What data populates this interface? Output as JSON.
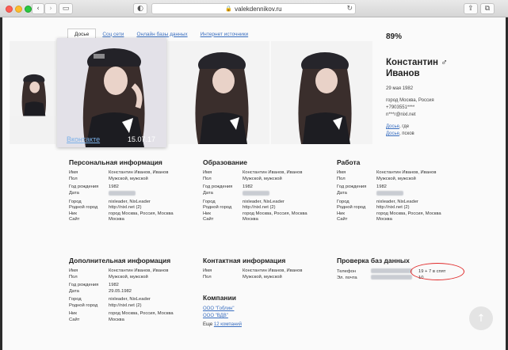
{
  "browser": {
    "url": "valekdennikov.ru"
  },
  "tabs": [
    "Досье",
    "Соц сети",
    "Онлайн базы данных",
    "Интернет источники"
  ],
  "match_percent": "89%",
  "photo": {
    "caption": "Вконтакте",
    "date": "15.07.17"
  },
  "profile": {
    "name_line1": "Константин ♂",
    "name_line2": "Иванов",
    "birth": "29 мая 1982",
    "city": "город Москва, Россия",
    "phone": "+7903551****",
    "email": "n***r@nixl.net",
    "link1": "Досье",
    "link1_rest": ", где",
    "link2": "Досье",
    "link2_rest": ", псков"
  },
  "personal": {
    "title": "Персональная информация",
    "rows": [
      {
        "k": "Имя",
        "v": "Константин Иванов, Иванов"
      },
      {
        "k": "Пол",
        "v": "Мужской, мужской"
      },
      {
        "k": "Год рождения",
        "v": "1982"
      },
      {
        "k": "Дата",
        "v": ""
      },
      {
        "k": "Город",
        "v": "nixleader, NixLeader"
      },
      {
        "k": "Родной город",
        "v": "http://nixl.net (2)"
      },
      {
        "k": "Ник",
        "v": "город Москва, Россия, Москва"
      },
      {
        "k": "Сайт",
        "v": "Москва"
      }
    ]
  },
  "education": {
    "title": "Образование",
    "rows": [
      {
        "k": "Имя",
        "v": "Константин Иванов, Иванов"
      },
      {
        "k": "Пол",
        "v": "Мужской, мужской"
      },
      {
        "k": "Год рождения",
        "v": "1982"
      },
      {
        "k": "Дата",
        "v": ""
      },
      {
        "k": "Город",
        "v": "nixleader, NixLeader"
      },
      {
        "k": "Родной город",
        "v": "http://nixl.net (2)"
      },
      {
        "k": "Ник",
        "v": "город Москва, Россия, Москва"
      },
      {
        "k": "Сайт",
        "v": "Москва"
      }
    ]
  },
  "work": {
    "title": "Работа",
    "rows": [
      {
        "k": "Имя",
        "v": "Константин Иванов, Иванов"
      },
      {
        "k": "Пол",
        "v": "Мужской, мужской"
      },
      {
        "k": "Год рождения",
        "v": "1982"
      },
      {
        "k": "Дата",
        "v": ""
      },
      {
        "k": "Город",
        "v": "nixleader, NixLeader"
      },
      {
        "k": "Родной город",
        "v": "http://nixl.net (2)"
      },
      {
        "k": "Ник",
        "v": "город Москва, Россия, Москва"
      },
      {
        "k": "Сайт",
        "v": "Москва"
      }
    ]
  },
  "additional": {
    "title": "Дополнительная информация",
    "rows": [
      {
        "k": "Имя",
        "v": "Константин Иванов, Иванов"
      },
      {
        "k": "Пол",
        "v": "Мужской, мужской"
      },
      {
        "k": "Год рождения",
        "v": "1982"
      },
      {
        "k": "Дата",
        "v": "29.05.1982"
      },
      {
        "k": "Город",
        "v": "nixleader, NixLeader"
      },
      {
        "k": "Родной город",
        "v": "http://nixl.net (2)"
      },
      {
        "k": "Ник",
        "v": "город Москва, Россия, Москва"
      },
      {
        "k": "Сайт",
        "v": "Москва"
      }
    ]
  },
  "contact": {
    "title": "Контактная информация",
    "rows": [
      {
        "k": "Имя",
        "v": "Константин Иванов, Иванов"
      },
      {
        "k": "Пол",
        "v": "Мужской, мужской"
      }
    ]
  },
  "companies": {
    "title": "Компании",
    "items": [
      "ООО \"Гоблин\"",
      "ООО \"ВДВ\""
    ],
    "more_prefix": "Еще",
    "more_link": "12 компаний"
  },
  "check": {
    "title": "Проверка баз данных",
    "rows": [
      {
        "k": "Телефон",
        "v": "19 + 7 в спят"
      },
      {
        "k": "Эл. почта",
        "v": "10"
      }
    ]
  },
  "icons": {
    "back": "chevron-left-icon",
    "forward": "chevron-right-icon",
    "sidebar": "sidebar-icon",
    "shield": "shield-icon",
    "lock": "lock-icon",
    "reload": "reload-icon",
    "share": "share-icon",
    "tabs": "tabs-icon",
    "scroll_top": "arrow-up-icon"
  },
  "colors": {
    "link": "#3a6fc0",
    "highlight_oval": "#e02a2a"
  }
}
